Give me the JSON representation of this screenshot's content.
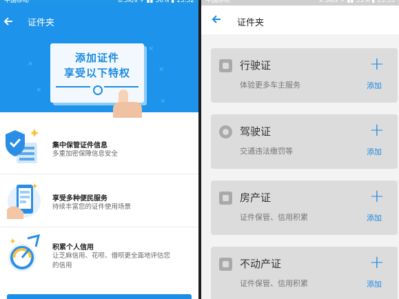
{
  "left": {
    "status": {
      "carrier": "中国移动",
      "right": "8.5K/s ✈ ▮▮ 56% ▮ 13:52"
    },
    "header": {
      "title": "证件夹",
      "back_icon": "arrow-left-icon"
    },
    "banner": {
      "line1": "添加证件",
      "line2": "享受以下特权"
    },
    "features": [
      {
        "title": "集中保管证件信息",
        "desc": "多重加密保障信息安全",
        "icon": "shield-server-icon"
      },
      {
        "title": "享受多种便民服务",
        "desc": "持续丰富您的证件使用场景",
        "icon": "phone-card-icon"
      },
      {
        "title": "积累个人信用",
        "desc": "让芝麻信用、花呗、借呗更全面地评估您的信用",
        "icon": "credit-gauge-icon"
      }
    ]
  },
  "right": {
    "status": {
      "carrier": "中国移动",
      "right": "9.5K/s ✈ ▮▮ 55% ▮ 13:53"
    },
    "header": {
      "title": "证件夹",
      "back_icon": "arrow-left-icon"
    },
    "cards": [
      {
        "name": "行驶证",
        "desc": "体验更多车主服务",
        "add": "添加",
        "icon": "car-icon"
      },
      {
        "name": "驾驶证",
        "desc": "交通违法缴罚等",
        "add": "添加",
        "icon": "steering-wheel-icon"
      },
      {
        "name": "房产证",
        "desc": "证件保管、信用积累",
        "add": "添加",
        "icon": "building-icon"
      },
      {
        "name": "不动产证",
        "desc": "证件保管、信用积累",
        "add": "添加",
        "icon": "building-icon"
      }
    ]
  },
  "colors": {
    "primary": "#1d93eb",
    "card_gray": "#dcdcdc"
  }
}
